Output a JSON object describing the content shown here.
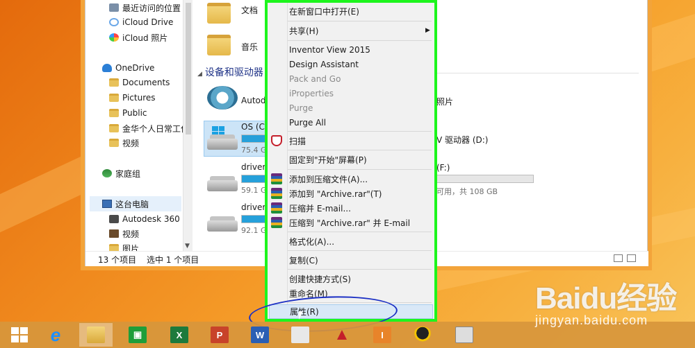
{
  "nav": {
    "items": [
      {
        "label": "最近访问的位置",
        "icon": "recent-places-icon"
      },
      {
        "label": "iCloud Drive",
        "icon": "icloud-icon"
      },
      {
        "label": "iCloud 照片",
        "icon": "icloud-photos-icon"
      },
      {
        "label": "OneDrive",
        "icon": "onedrive-icon"
      },
      {
        "label": "Documents",
        "icon": "folder-icon"
      },
      {
        "label": "Pictures",
        "icon": "folder-icon"
      },
      {
        "label": "Public",
        "icon": "folder-icon"
      },
      {
        "label": "金华个人日常工作",
        "icon": "folder-icon"
      },
      {
        "label": "视频",
        "icon": "folder-icon"
      },
      {
        "label": "家庭组",
        "icon": "homegroup-icon"
      },
      {
        "label": "这台电脑",
        "icon": "this-pc-icon"
      },
      {
        "label": "Autodesk 360",
        "icon": "autodesk-icon"
      },
      {
        "label": "视频",
        "icon": "video-icon"
      },
      {
        "label": "图片",
        "icon": "pictures-icon"
      }
    ]
  },
  "content": {
    "folder_docs": "文档",
    "folder_music": "音乐",
    "section_devices": "设备和驱动器",
    "autodesk_label": "Autod",
    "os_label": "OS (C:",
    "os_size": "75.4 G",
    "driver1_label": "driver",
    "driver1_size": "59.1 G",
    "driver2_label": "driver",
    "driver2_size": "92.1 G",
    "right_photos": "照片",
    "right_dvd": "V 驱动器 (D:)",
    "right_f": "(F:)",
    "right_f_free": "可用，共 108 GB"
  },
  "status": {
    "count": "13 个项目",
    "selected": "选中 1 个项目"
  },
  "menu": {
    "open_new_window": "在新窗口中打开(E)",
    "share": "共享(H)",
    "inventor_view": "Inventor View 2015",
    "design_assistant": "Design Assistant",
    "pack_and_go": "Pack and Go",
    "iproperties": "iProperties",
    "purge": "Purge",
    "purge_all": "Purge All",
    "scan": "扫描",
    "pin_start": "固定到\"开始\"屏幕(P)",
    "add_archive": "添加到压缩文件(A)...",
    "add_archive_rar": "添加到 \"Archive.rar\"(T)",
    "compress_email": "压缩并 E-mail...",
    "compress_rar_email": "压缩到 \"Archive.rar\" 并 E-mail",
    "format": "格式化(A)...",
    "copy": "复制(C)",
    "create_shortcut": "创建快捷方式(S)",
    "rename": "重命名(M)",
    "properties": "属性(R)"
  },
  "taskbar": {
    "excel": "X",
    "powerpoint": "P",
    "word": "W",
    "inventor": "I"
  },
  "watermark": {
    "logo": "Baidu经验",
    "url": "jingyan.baidu.com"
  },
  "colors": {
    "menu_border": "#1df51d",
    "annotation": "#1b2fc4",
    "highlight": "#d9e8f7"
  }
}
